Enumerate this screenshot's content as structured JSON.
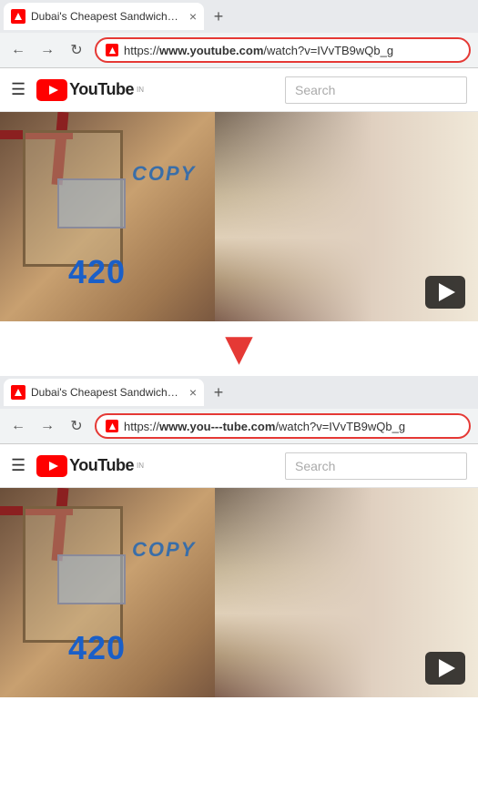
{
  "top_browser": {
    "tab": {
      "title": "Dubai's Cheapest Sandwich?! (Th...",
      "favicon_color": "#ff0000",
      "close_label": "×",
      "new_tab_label": "+"
    },
    "omnibar": {
      "back_icon": "←",
      "forward_icon": "→",
      "refresh_icon": "↻",
      "url_display": "https://www.youtube.com/watch?v=IVvTB9wQb_g",
      "url_prefix": "https://",
      "url_bold": "www.youtube.com",
      "url_suffix": "/watch?v=IVvTB9wQb_g"
    }
  },
  "top_youtube": {
    "hamburger_icon": "☰",
    "logo_text": "YouTube",
    "country_badge": "IN",
    "search_placeholder": "Search"
  },
  "top_video": {
    "copy_text": "COPY",
    "number_text": "420",
    "play_icon": "▶"
  },
  "arrow": {
    "icon": "▼"
  },
  "bottom_browser": {
    "tab": {
      "title": "Dubai's Cheapest Sandwich?! (Th...",
      "favicon_color": "#ff0000",
      "close_label": "×",
      "new_tab_label": "+"
    },
    "omnibar": {
      "back_icon": "←",
      "forward_icon": "→",
      "refresh_icon": "↻",
      "url_display": "https://www.you---tube.com/watch?v=IVvTB9wQb_g",
      "url_prefix": "https://",
      "url_bold": "www.you---tube.com",
      "url_suffix": "/watch?v=IVvTB9wQb_g"
    }
  },
  "bottom_youtube": {
    "hamburger_icon": "☰",
    "logo_text": "YouTube",
    "country_badge": "IN",
    "search_placeholder": "Search"
  },
  "bottom_video": {
    "copy_text": "COPY",
    "number_text": "420",
    "play_icon": "▶"
  }
}
